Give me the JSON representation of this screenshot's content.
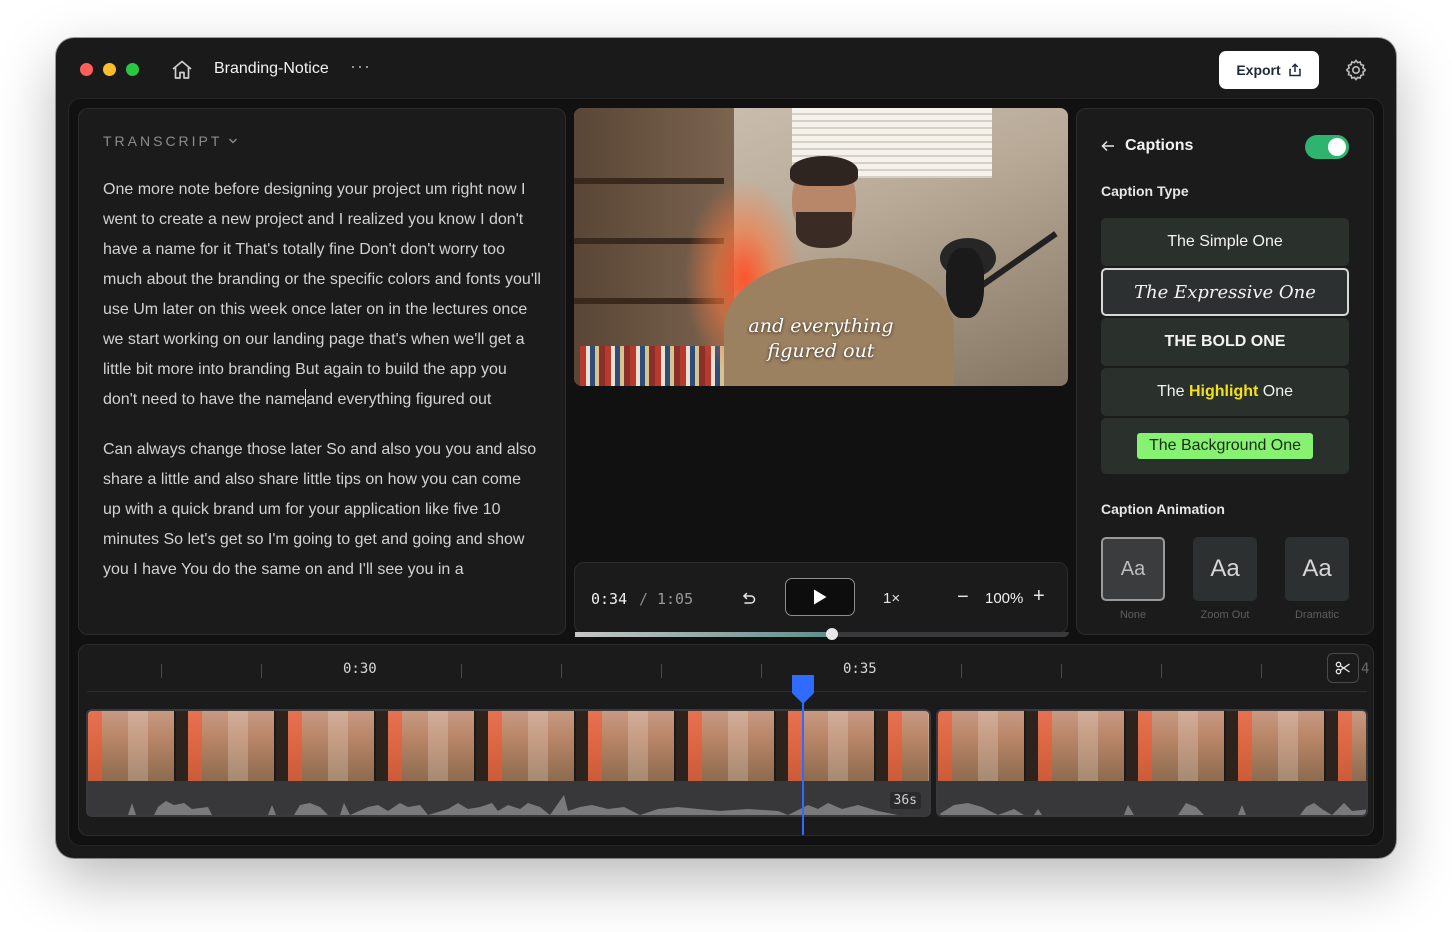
{
  "window": {
    "title": "Branding-Notice",
    "more_label": "···",
    "export_label": "Export"
  },
  "transcript": {
    "header": "TRANSCRIPT",
    "paragraphs": [
      "One more note before designing your project um right now I went to create a new project and I realized you know I don't have a name for it That's totally fine Don't don't worry too much about the branding or the specific colors and fonts you'll use Um later on this week once later on in the lectures once we start working on our landing page that's when we'll get a little bit more into branding But again to build the app you don't need to have the name",
      "and everything figured out",
      "Can always change those later So and also you you and also share a little and also share little tips on how you can come up with a quick brand um for your application like five 10 minutes So let's get so I'm going to get and going and show you I have You do the same on and I'll see you in a"
    ]
  },
  "video": {
    "caption_line1": "and everything",
    "caption_line2": "figured out"
  },
  "player": {
    "current_time": "0:34",
    "separator": "/",
    "total_time": "1:05",
    "speed": "1×",
    "zoom": "100%",
    "progress": 0.52
  },
  "captions_panel": {
    "title": "Captions",
    "enabled": true,
    "caption_type_label": "Caption Type",
    "types": {
      "simple": "The Simple One",
      "expressive": "The Expressive One",
      "bold": "THE BOLD ONE",
      "highlight_pre": "The",
      "highlight_word": "Highlight",
      "highlight_post": "One",
      "background": "The Background One"
    },
    "selected_type": "The Expressive One",
    "animation_label": "Caption Animation",
    "animations": [
      {
        "glyph": "Aa",
        "label": "None"
      },
      {
        "glyph": "Aa",
        "label": "Zoom Out"
      },
      {
        "glyph": "Aa",
        "label": "Dramatic"
      }
    ],
    "selected_animation": "None"
  },
  "timeline": {
    "tick_labels": [
      "0:30",
      "0:35"
    ],
    "clip1_duration": "36s",
    "partial_label": "4"
  },
  "colors": {
    "accent_blue": "#2f6bff",
    "toggle_green": "#2fb470",
    "highlight_yellow": "#f5e11a",
    "background_green": "#87f272"
  }
}
